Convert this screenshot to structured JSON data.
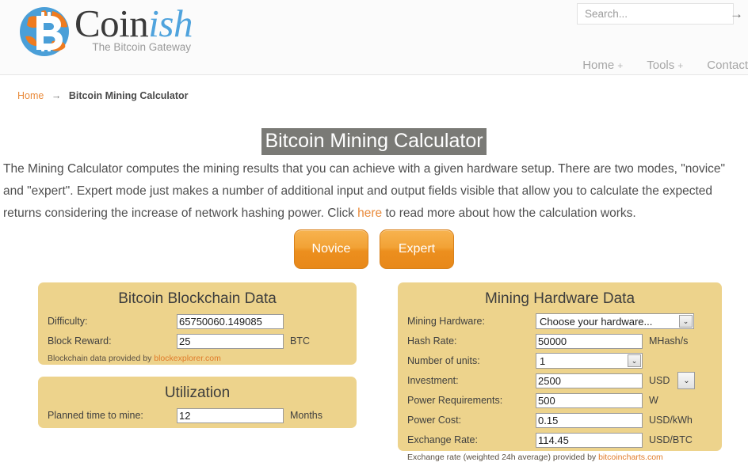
{
  "header": {
    "brand_name_part1": "Coin",
    "brand_name_part2": "ish",
    "tagline": "The Bitcoin Gateway",
    "search_placeholder": "Search...",
    "search_value": "",
    "search_arrow_icon": "→",
    "nav": [
      {
        "label": "Home",
        "plus": "+"
      },
      {
        "label": "Tools",
        "plus": "+"
      },
      {
        "label": "Contact",
        "plus": ""
      }
    ]
  },
  "breadcrumb": {
    "home": "Home",
    "separator": "→",
    "current": "Bitcoin Mining Calculator"
  },
  "page": {
    "title": "Bitcoin Mining Calculator",
    "intro_part1": "The Mining Calculator computes the mining results that you can achieve with a given hardware setup. There are two modes, \"novice\" and \"expert\". Expert mode just makes a number of additional input and output fields visible that allow you to calculate the expected returns considering the increase of network hashing power. Click ",
    "intro_link": "here",
    "intro_part2": " to read more about how the calculation works."
  },
  "modes": {
    "novice": "Novice",
    "expert": "Expert"
  },
  "blockchain_panel": {
    "title": "Bitcoin Blockchain Data",
    "difficulty_label": "Difficulty:",
    "difficulty_value": "65750060.149085",
    "reward_label": "Block Reward:",
    "reward_value": "25",
    "reward_unit": "BTC",
    "note_text": "Blockchain data provided by ",
    "note_link": "blockexplorer.com"
  },
  "utilization_panel": {
    "title": "Utilization",
    "time_label": "Planned time to mine:",
    "time_value": "12",
    "time_unit": "Months"
  },
  "hardware_panel": {
    "title": "Mining Hardware Data",
    "hardware_label": "Mining Hardware:",
    "hardware_selected": "Choose your hardware...",
    "hashrate_label": "Hash Rate:",
    "hashrate_value": "50000",
    "hashrate_unit": "MHash/s",
    "units_label": "Number of units:",
    "units_selected": "1",
    "investment_label": "Investment:",
    "investment_value": "2500",
    "investment_unit": "USD",
    "power_label": "Power Requirements:",
    "power_value": "500",
    "power_unit": "W",
    "powercost_label": "Power Cost:",
    "powercost_value": "0.15",
    "powercost_unit": "USD/kWh",
    "exchange_label": "Exchange Rate:",
    "exchange_value": "114.45",
    "exchange_unit": "USD/BTC",
    "note_text": "Exchange rate (weighted 24h average) provided by ",
    "note_link": "bitcoincharts.com"
  },
  "icons": {
    "chevron_down": "⌄"
  },
  "colors": {
    "panel_bg": "#edd38c",
    "accent_orange": "#e98a3a",
    "button_orange": "#f2a236",
    "brand_blue": "#4fa3dd",
    "title_bg": "#7a7a76"
  }
}
